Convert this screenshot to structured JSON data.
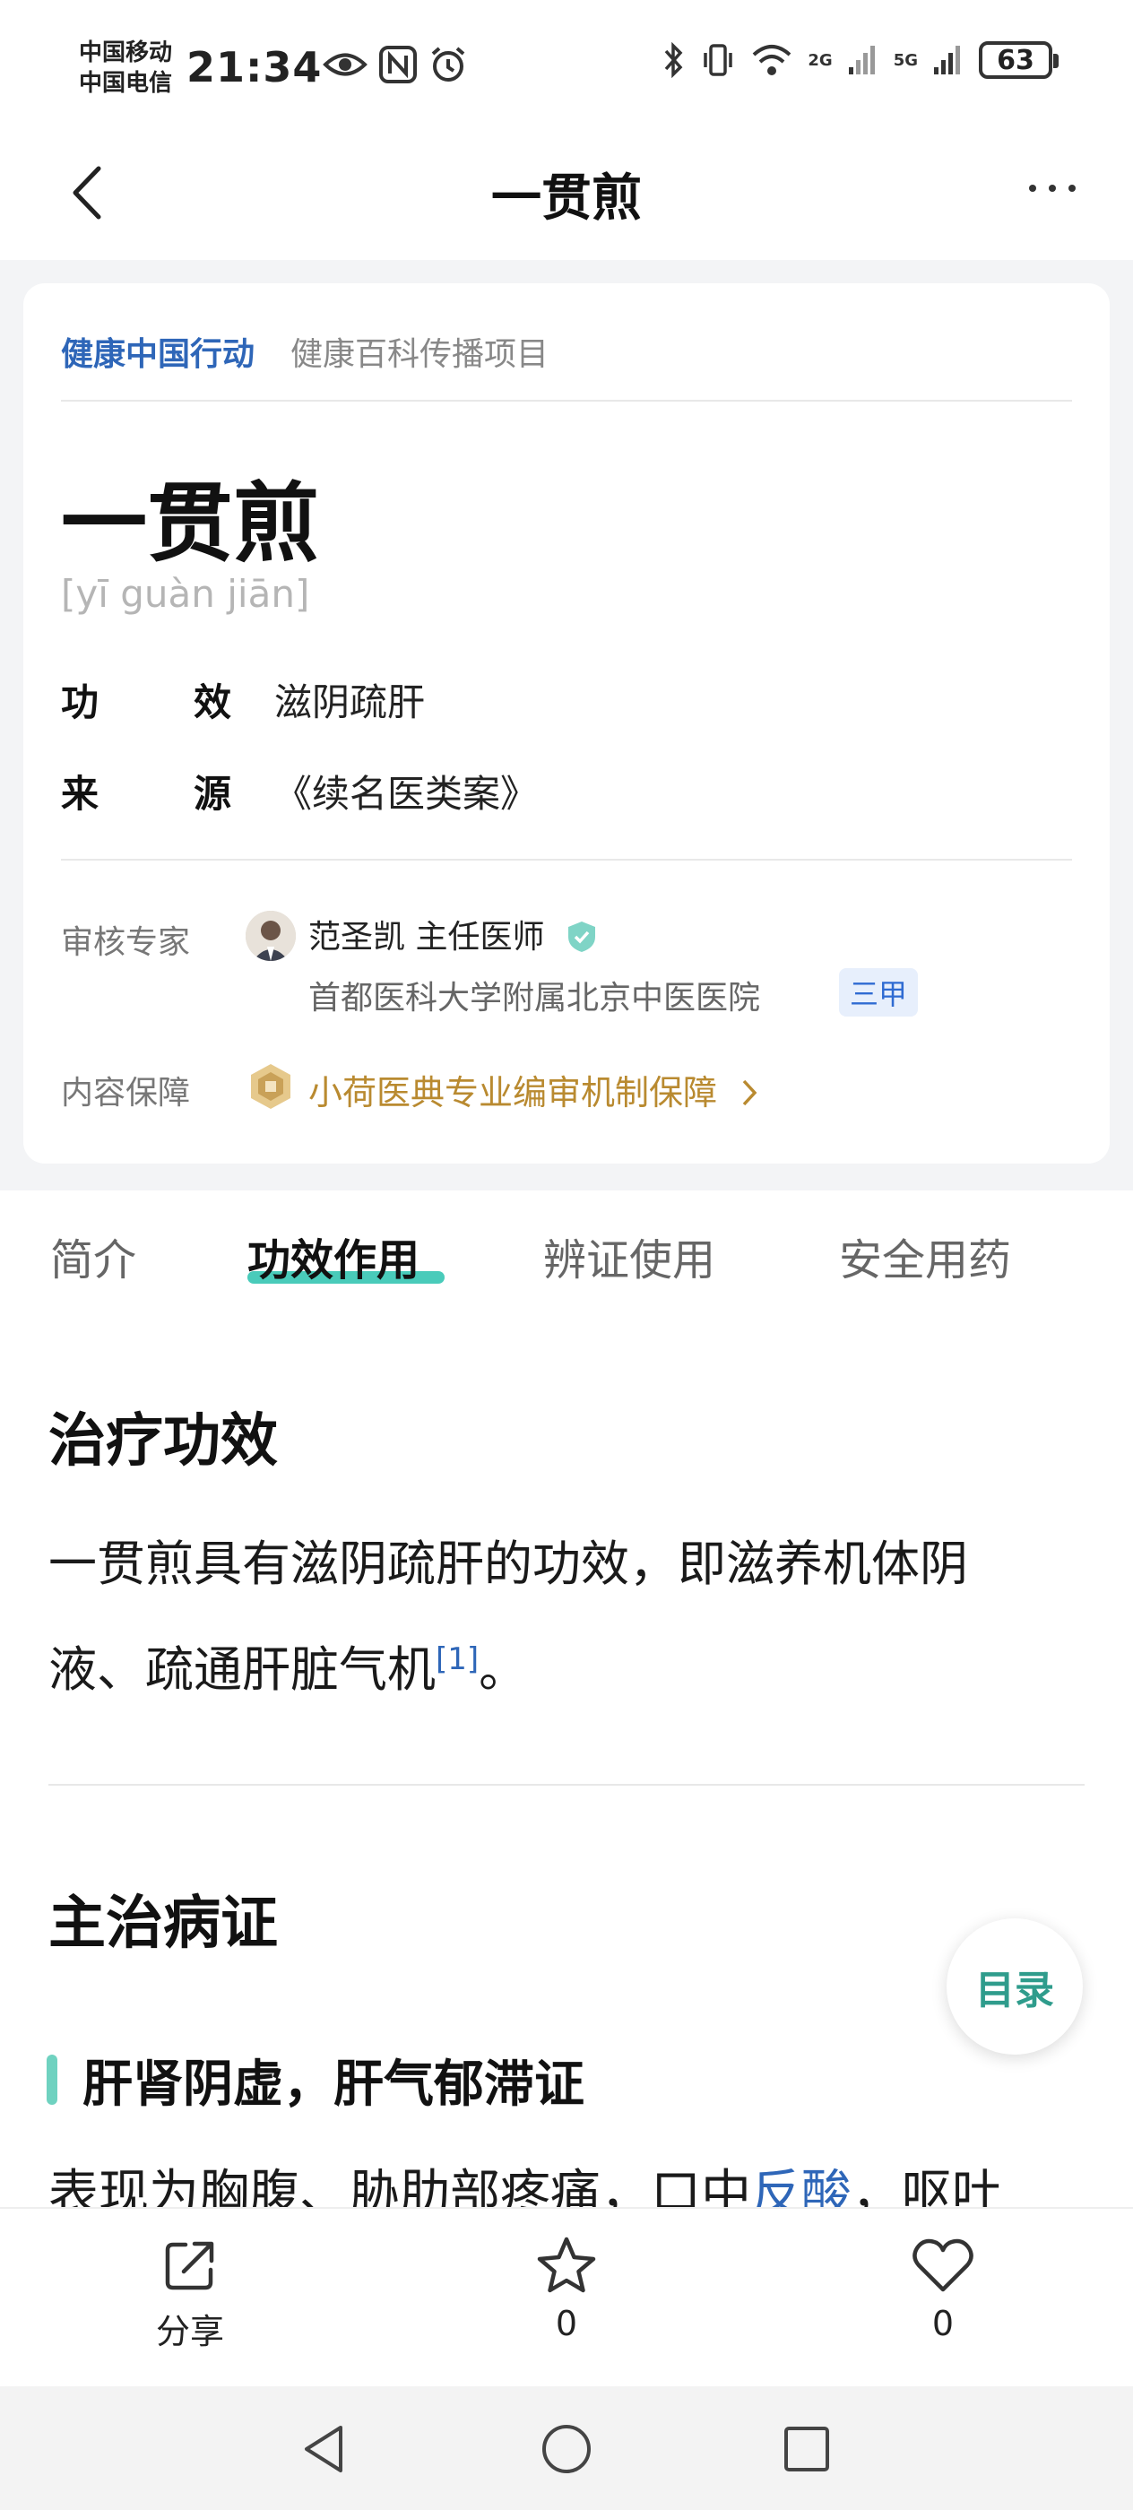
{
  "status_bar": {
    "carrier1": "中国移动",
    "carrier2": "中国电信",
    "time": "21:34",
    "battery": "63",
    "net1": "2G",
    "net2": "5G"
  },
  "nav": {
    "title": "一贯煎"
  },
  "card": {
    "tag_primary": "健康中国行动",
    "tag_secondary": "健康百科传播项目",
    "title": "一贯煎",
    "pinyin": "[yī guàn jiān]",
    "fields": [
      {
        "k1": "功",
        "k2": "效",
        "value": "滋阴疏肝"
      },
      {
        "k1": "来",
        "k2": "源",
        "value": "《续名医类案》"
      }
    ],
    "reviewer_label": "审核专家",
    "doctor": "范圣凯 主任医师",
    "hospital": "首都医科大学附属北京中医医院",
    "hospital_badge": "三甲",
    "guarantee_label": "内容保障",
    "guarantee_text": "小荷医典专业编审机制保障"
  },
  "tabs": [
    "简介",
    "功效作用",
    "辨证使用",
    "安全用药"
  ],
  "active_tab": "功效作用",
  "sections": {
    "effect_title": "治疗功效",
    "effect_text_1": "一贯煎具有滋阴疏肝的功效，即滋养机体阴",
    "effect_text_2": "液、疏通肝脏气机",
    "effect_ref": "[1]",
    "effect_end": "。",
    "indication_title": "主治病证",
    "sub_title": "肝肾阴虚，肝气郁滞证",
    "partial_line_a": "表现为胸腹、胁肋部疼痛，口中",
    "partial_line_link": "反酸",
    "partial_line_b": "，呕吐"
  },
  "toc_label": "目录",
  "actions": {
    "share_label": "分享",
    "favorite_count": "0",
    "like_count": "0"
  }
}
